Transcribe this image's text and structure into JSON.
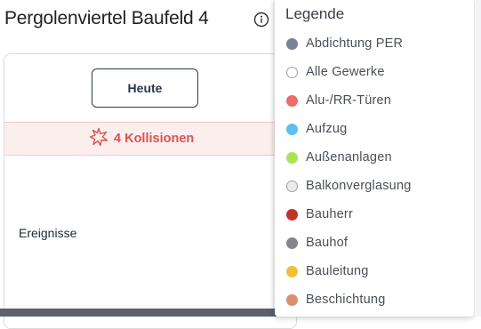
{
  "header": {
    "title": "Pergolenviertel Baufeld 4",
    "info_icon": "info-circle-icon"
  },
  "toolbar": {
    "today_label": "Heute"
  },
  "collisions": {
    "label": "4 Kollisionen",
    "icon": "collision-burst-icon",
    "color": "#d9534f",
    "background": "#fdeeee"
  },
  "timeline": {
    "events_label": "Ereignisse"
  },
  "legend": {
    "title": "Legende",
    "items": [
      {
        "label": "Abdichtung PER",
        "color": "#7a8194",
        "outlined": false
      },
      {
        "label": "Alle Gewerke",
        "color": "#ffffff",
        "outlined": true
      },
      {
        "label": "Alu-/RR-Türen",
        "color": "#ec6b6b",
        "outlined": false
      },
      {
        "label": "Aufzug",
        "color": "#5bc0f0",
        "outlined": false
      },
      {
        "label": "Außenanlagen",
        "color": "#a8e455",
        "outlined": false
      },
      {
        "label": "Balkonverglasung",
        "color": "#ececec",
        "outlined": true
      },
      {
        "label": "Bauherr",
        "color": "#c2322b",
        "outlined": false
      },
      {
        "label": "Bauhof",
        "color": "#85878c",
        "outlined": false
      },
      {
        "label": "Bauleitung",
        "color": "#f2bf3c",
        "outlined": false
      },
      {
        "label": "Beschichtung",
        "color": "#d98f72",
        "outlined": false
      }
    ]
  }
}
